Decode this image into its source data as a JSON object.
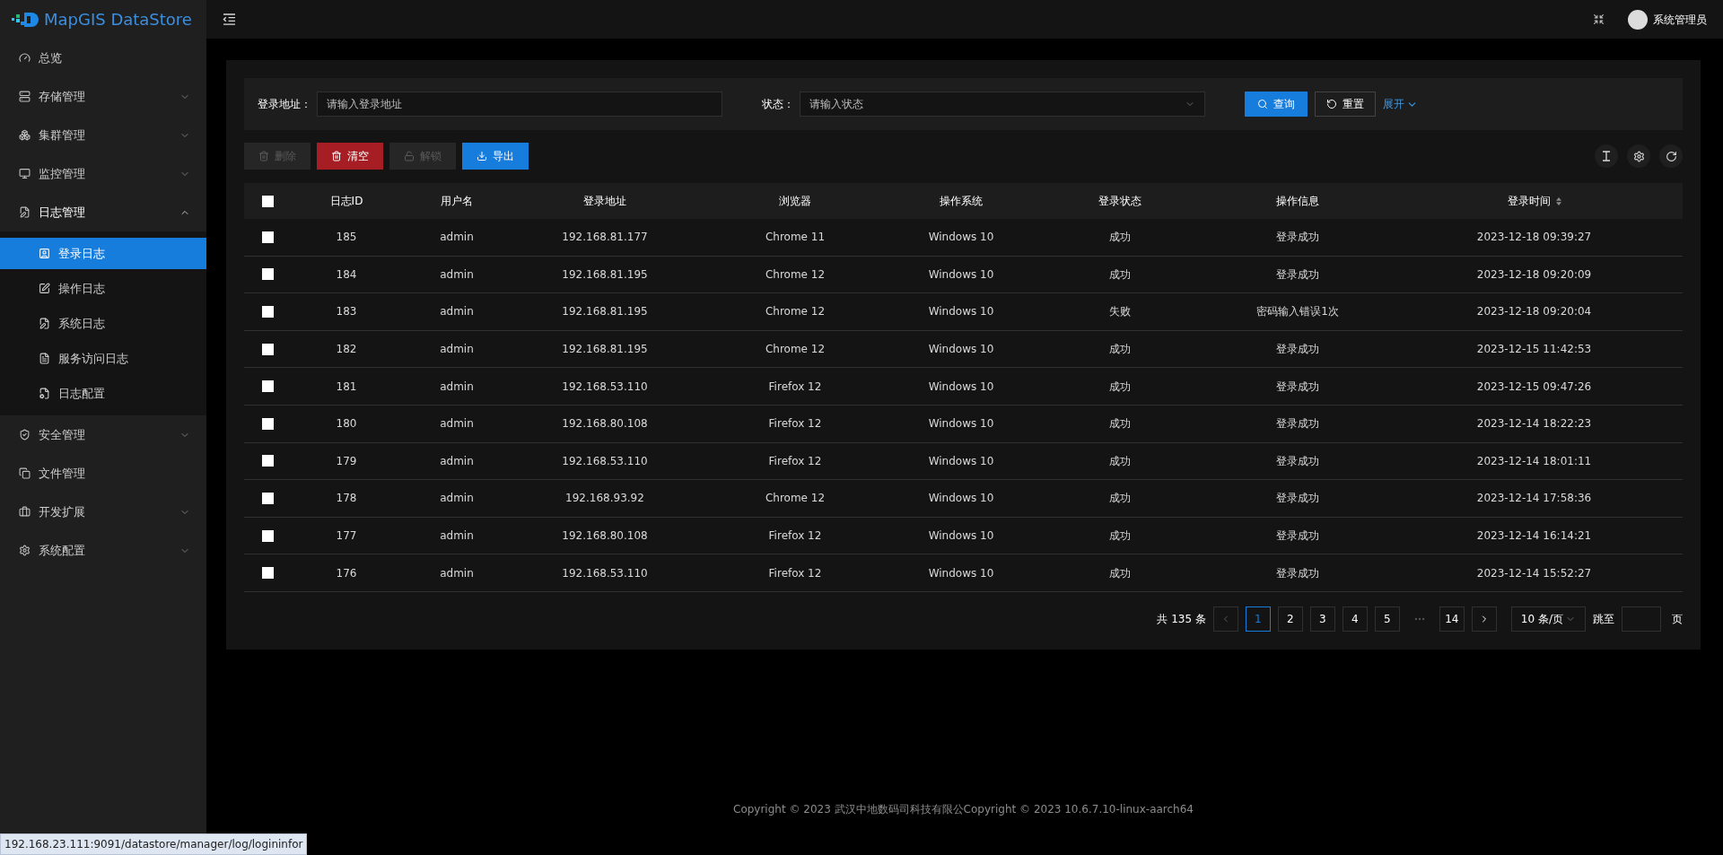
{
  "logo": {
    "text": "MapGIS DataStore"
  },
  "sidebar": {
    "items": [
      {
        "label": "总览",
        "kind": "link"
      },
      {
        "label": "存储管理",
        "kind": "group",
        "expanded": false
      },
      {
        "label": "集群管理",
        "kind": "group",
        "expanded": false
      },
      {
        "label": "监控管理",
        "kind": "group",
        "expanded": false
      },
      {
        "label": "日志管理",
        "kind": "group",
        "expanded": true,
        "children": [
          {
            "label": "登录日志",
            "selected": true
          },
          {
            "label": "操作日志",
            "selected": false
          },
          {
            "label": "系统日志",
            "selected": false
          },
          {
            "label": "服务访问日志",
            "selected": false
          },
          {
            "label": "日志配置",
            "selected": false
          }
        ]
      },
      {
        "label": "安全管理",
        "kind": "group",
        "expanded": false
      },
      {
        "label": "文件管理",
        "kind": "link"
      },
      {
        "label": "开发扩展",
        "kind": "group",
        "expanded": false
      },
      {
        "label": "系统配置",
        "kind": "group",
        "expanded": false
      }
    ]
  },
  "header": {
    "user": "系统管理员"
  },
  "filters": [
    {
      "label": "登录地址：",
      "placeholder": "请输入登录地址",
      "kind": "text"
    },
    {
      "label": "状态：",
      "placeholder": "请输入状态",
      "kind": "select"
    }
  ],
  "filter_buttons": {
    "search": "查询",
    "reset": "重置",
    "expand": "展开"
  },
  "actions": [
    {
      "label": "删除",
      "kind": "delete",
      "disabled": true
    },
    {
      "label": "清空",
      "kind": "clear",
      "disabled": false
    },
    {
      "label": "解锁",
      "kind": "unlock",
      "disabled": true
    },
    {
      "label": "导出",
      "kind": "export",
      "disabled": false
    }
  ],
  "table": {
    "all_checked": false,
    "columns": [
      {
        "label": "日志ID",
        "sortable": false
      },
      {
        "label": "用户名",
        "sortable": false
      },
      {
        "label": "登录地址",
        "sortable": false
      },
      {
        "label": "浏览器",
        "sortable": false
      },
      {
        "label": "操作系统",
        "sortable": false
      },
      {
        "label": "登录状态",
        "sortable": false
      },
      {
        "label": "操作信息",
        "sortable": false
      },
      {
        "label": "登录时间",
        "sortable": true
      }
    ],
    "rows": [
      {
        "checked": false,
        "cells": [
          "185",
          "admin",
          "192.168.81.177",
          "Chrome 11",
          "Windows 10",
          "成功",
          "登录成功",
          "2023-12-18 09:39:27"
        ]
      },
      {
        "checked": false,
        "cells": [
          "184",
          "admin",
          "192.168.81.195",
          "Chrome 12",
          "Windows 10",
          "成功",
          "登录成功",
          "2023-12-18 09:20:09"
        ]
      },
      {
        "checked": false,
        "cells": [
          "183",
          "admin",
          "192.168.81.195",
          "Chrome 12",
          "Windows 10",
          "失败",
          "密码输入错误1次",
          "2023-12-18 09:20:04"
        ]
      },
      {
        "checked": false,
        "cells": [
          "182",
          "admin",
          "192.168.81.195",
          "Chrome 12",
          "Windows 10",
          "成功",
          "登录成功",
          "2023-12-15 11:42:53"
        ]
      },
      {
        "checked": false,
        "cells": [
          "181",
          "admin",
          "192.168.53.110",
          "Firefox 12",
          "Windows 10",
          "成功",
          "登录成功",
          "2023-12-15 09:47:26"
        ]
      },
      {
        "checked": false,
        "cells": [
          "180",
          "admin",
          "192.168.80.108",
          "Firefox 12",
          "Windows 10",
          "成功",
          "登录成功",
          "2023-12-14 18:22:23"
        ]
      },
      {
        "checked": false,
        "cells": [
          "179",
          "admin",
          "192.168.53.110",
          "Firefox 12",
          "Windows 10",
          "成功",
          "登录成功",
          "2023-12-14 18:01:11"
        ]
      },
      {
        "checked": false,
        "cells": [
          "178",
          "admin",
          "192.168.93.92",
          "Chrome 12",
          "Windows 10",
          "成功",
          "登录成功",
          "2023-12-14 17:58:36"
        ]
      },
      {
        "checked": false,
        "cells": [
          "177",
          "admin",
          "192.168.80.108",
          "Firefox 12",
          "Windows 10",
          "成功",
          "登录成功",
          "2023-12-14 16:14:21"
        ]
      },
      {
        "checked": false,
        "cells": [
          "176",
          "admin",
          "192.168.53.110",
          "Firefox 12",
          "Windows 10",
          "成功",
          "登录成功",
          "2023-12-14 15:52:27"
        ]
      }
    ]
  },
  "pagination": {
    "total": "共 135 条",
    "pages": [
      {
        "label": "1",
        "kind": "page",
        "selected": true
      },
      {
        "label": "2",
        "kind": "page",
        "selected": false
      },
      {
        "label": "3",
        "kind": "page",
        "selected": false
      },
      {
        "label": "4",
        "kind": "page",
        "selected": false
      },
      {
        "label": "5",
        "kind": "page",
        "selected": false
      },
      {
        "kind": "ellipsis"
      },
      {
        "label": "14",
        "kind": "page",
        "selected": false
      }
    ],
    "page_size": "10 条/页",
    "jump_label": "跳至",
    "jump_suffix": "页"
  },
  "footer": "Copyright © 2023 武汉中地数码司科技有限公Copyright © 2023 10.6.7.10-linux-aarch64",
  "status_url": "192.168.23.111:9091/datastore/manager/log/logininfor"
}
